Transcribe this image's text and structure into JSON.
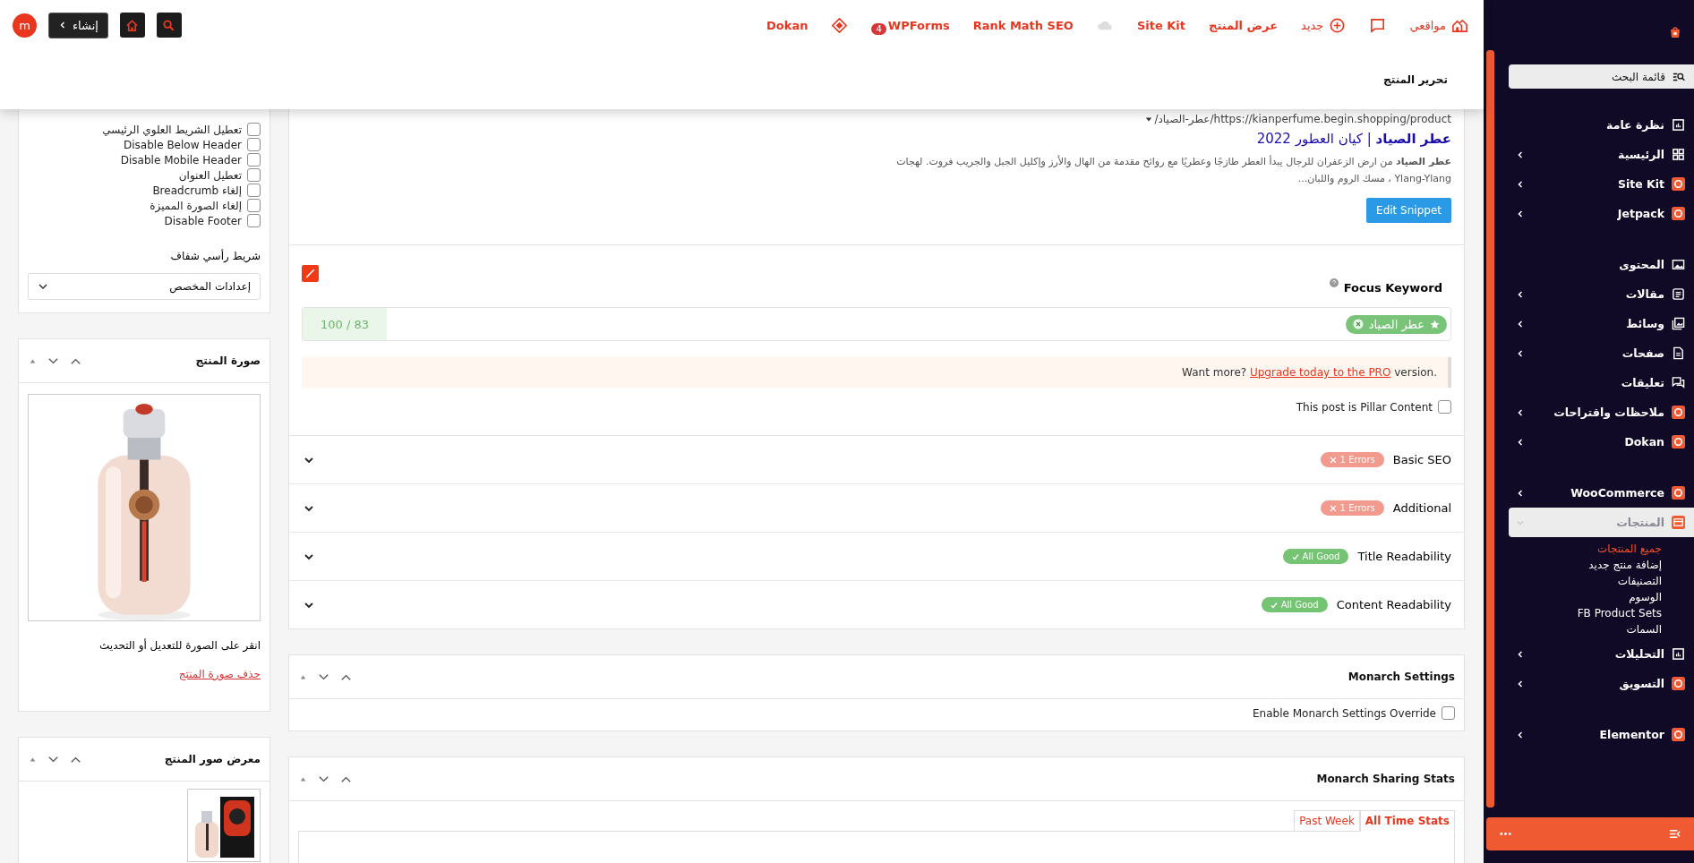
{
  "adminbar": {
    "items": [
      {
        "kind": "icon-link",
        "label": "مواقعي"
      },
      {
        "kind": "icon"
      },
      {
        "kind": "icon-link",
        "label": "جديد"
      },
      {
        "kind": "link",
        "label": "عرض المنتج"
      },
      {
        "kind": "link",
        "label": "Site Kit"
      },
      {
        "kind": "icon"
      },
      {
        "kind": "link",
        "label": "Rank Math SEO"
      },
      {
        "kind": "link",
        "label": "WPForms",
        "badge": "4"
      },
      {
        "kind": "icon"
      },
      {
        "kind": "link",
        "label": "Dokan"
      }
    ],
    "create_label": "إنشاء",
    "avatar": "m"
  },
  "page_title": "تحرير المنتج",
  "sidebar": {
    "search_placeholder": "قائمة البحث",
    "groups": [
      {
        "items": [
          {
            "label": "نظرة عامة",
            "submenu": false,
            "selected": false
          },
          {
            "label": "الرئيسية",
            "submenu": true,
            "selected": false
          },
          {
            "label": "Site Kit",
            "submenu": true,
            "selected": false
          },
          {
            "label": "Jetpack",
            "submenu": true,
            "selected": false
          }
        ]
      },
      {
        "items": [
          {
            "label": "المحتوى",
            "submenu": false,
            "selected": false
          },
          {
            "label": "مقالات",
            "submenu": true,
            "selected": false
          },
          {
            "label": "وسائط",
            "submenu": true,
            "selected": false
          },
          {
            "label": "صفحات",
            "submenu": true,
            "selected": false
          },
          {
            "label": "تعليقات",
            "submenu": false,
            "selected": false
          },
          {
            "label": "ملاحظات واقتراحات",
            "submenu": true,
            "selected": false
          },
          {
            "label": "Dokan",
            "submenu": true,
            "selected": false
          }
        ]
      },
      {
        "items": [
          {
            "label": "WooCommerce",
            "submenu": true,
            "selected": false
          },
          {
            "label": "المنتجات",
            "submenu": true,
            "expanded": true,
            "selected": true,
            "children": [
              {
                "label": "جميع المنتجات",
                "selected": true
              },
              {
                "label": "إضافة منتج جديد",
                "selected": false
              },
              {
                "label": "التصنيفات",
                "selected": false
              },
              {
                "label": "الوسوم",
                "selected": false
              },
              {
                "label": "FB Product Sets",
                "selected": false
              },
              {
                "label": "السمات",
                "selected": false
              }
            ]
          },
          {
            "label": "التحليلات",
            "submenu": true,
            "selected": false
          },
          {
            "label": "التسويق",
            "submenu": true,
            "selected": false
          }
        ]
      },
      {
        "items": [
          {
            "label": "Elementor",
            "submenu": true,
            "selected": false
          }
        ]
      }
    ]
  },
  "left_column": {
    "checkboxes": [
      {
        "label": "تعطيل الشريط العلوي الرئيسي",
        "checked": false
      },
      {
        "label": "Disable Below Header",
        "checked": false
      },
      {
        "label": "Disable Mobile Header",
        "checked": false
      },
      {
        "label": "تعطيل العنوان",
        "checked": false
      },
      {
        "label": "إلغاء Breadcrumb",
        "checked": false
      },
      {
        "label": "إلغاء الصورة المميزة",
        "checked": false
      },
      {
        "label": "Disable Footer",
        "checked": false
      }
    ],
    "select_label": "شريط رأسي شفاف",
    "select_value": "إعدادات المخصص",
    "product_image": {
      "title": "صورة المنتج",
      "caption": "انقر على الصورة للتعديل أو التحديث",
      "remove_link": "حذف صورة المنتج"
    },
    "gallery": {
      "title": "معرض صور المنتج"
    }
  },
  "seo": {
    "snippet": {
      "url": "https://kianperfume.begin.shopping/product/عطر-الصياد/",
      "title": "**عطر الصياد** | كيان العطور 2022",
      "description": "**عطر الصياد** من ارض الزعفران للرجال يبدأ العطر طازجًا وعطريًا مع روائح مقدمة من الهال والأرز وإكليل الجبل والجريب فروت. لهجات Ylang-Ylang ، مسك الروم واللبان...",
      "edit_button": "Edit Snippet"
    },
    "focus_keyword": {
      "label": "Focus Keyword",
      "keyword": "عطر الصياد",
      "score": "100 / 83"
    },
    "notice": {
      "before": "Want more? ",
      "link": "Upgrade today to the PRO",
      "after": " version."
    },
    "pillar": {
      "label": "This post is Pillar Content",
      "checked": false
    },
    "sections": [
      {
        "label": "Basic SEO",
        "expanded": false,
        "status": {
          "kind": "error",
          "text": "1 Errors"
        }
      },
      {
        "label": "Additional",
        "expanded": false,
        "status": {
          "kind": "error",
          "text": "1 Errors"
        }
      },
      {
        "label": "Title Readability",
        "expanded": false,
        "status": {
          "kind": "good",
          "text": "All Good"
        }
      },
      {
        "label": "Content Readability",
        "expanded": false,
        "status": {
          "kind": "good",
          "text": "All Good"
        }
      }
    ]
  },
  "monarch_settings": {
    "title": "Monarch Settings",
    "override": {
      "label": "Enable Monarch Settings Override",
      "checked": false
    }
  },
  "monarch_stats": {
    "title": "Monarch Sharing Stats",
    "tabs": [
      {
        "label": "All Time Stats",
        "selected": true
      },
      {
        "label": "Past Week",
        "selected": false
      }
    ]
  }
}
